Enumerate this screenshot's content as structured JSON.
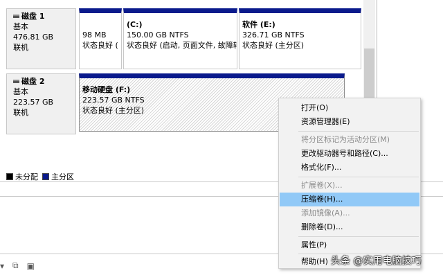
{
  "disks": [
    {
      "name": "磁盘 1",
      "type": "基本",
      "size": "476.81 GB",
      "status": "联机",
      "volumes": [
        {
          "title": "",
          "size": "98 MB",
          "status": "状态良好 ("
        },
        {
          "title": "(C:)",
          "size": "150.00 GB NTFS",
          "status": "状态良好 (启动, 页面文件, 故障转"
        },
        {
          "title": "软件  (E:)",
          "size": "326.71 GB NTFS",
          "status": "状态良好 (主分区)"
        }
      ]
    },
    {
      "name": "磁盘 2",
      "type": "基本",
      "size": "223.57 GB",
      "status": "联机",
      "volumes": [
        {
          "title": "移动硬盘  (F:)",
          "size": "223.57 GB NTFS",
          "status": "状态良好 (主分区)"
        }
      ]
    }
  ],
  "legend": [
    {
      "label": "未分配",
      "color": "#000000"
    },
    {
      "label": "主分区",
      "color": "#0a1a8c"
    }
  ],
  "context_menu": {
    "items": [
      {
        "label": "打开(O)",
        "disabled": false,
        "highlighted": false
      },
      {
        "label": "资源管理器(E)",
        "disabled": false,
        "highlighted": false
      },
      {
        "label": "将分区标记为活动分区(M)",
        "disabled": true,
        "highlighted": false
      },
      {
        "label": "更改驱动器号和路径(C)...",
        "disabled": false,
        "highlighted": false
      },
      {
        "label": "格式化(F)...",
        "disabled": false,
        "highlighted": false
      },
      {
        "label": "扩展卷(X)...",
        "disabled": true,
        "highlighted": false
      },
      {
        "label": "压缩卷(H)...",
        "disabled": false,
        "highlighted": true
      },
      {
        "label": "添加镜像(A)...",
        "disabled": true,
        "highlighted": false
      },
      {
        "label": "删除卷(D)...",
        "disabled": false,
        "highlighted": false
      },
      {
        "label": "属性(P)",
        "disabled": false,
        "highlighted": false
      },
      {
        "label": "帮助(H)",
        "disabled": false,
        "highlighted": false
      }
    ]
  },
  "watermark": "头条 @实用电脑技巧",
  "colors": {
    "primary_partition": "#0a1a8c",
    "menu_highlight": "#91c9f7"
  },
  "icons": [
    "disk-icon",
    "dropdown-arrow-icon",
    "copy-icon",
    "calendar-icon"
  ]
}
